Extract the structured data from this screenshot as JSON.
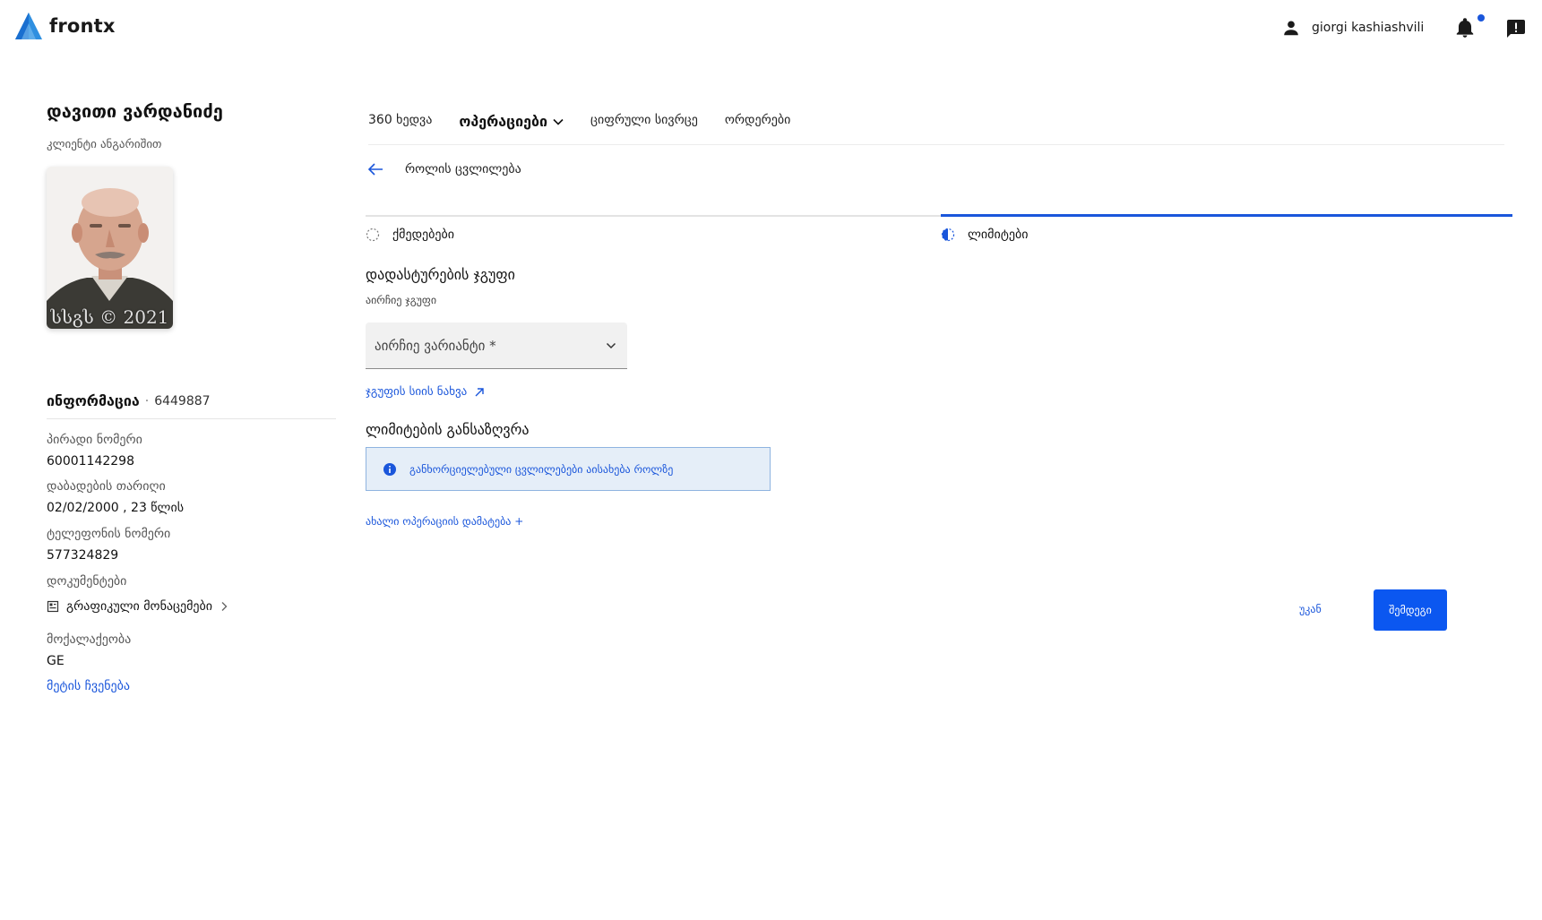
{
  "app": {
    "logo_text": "frontx",
    "user_name": "giorgi kashiashvili",
    "brand_color": "#1a56db",
    "primary_button_color": "#0b57f0"
  },
  "client": {
    "name": "დავითი ვარდანიძე",
    "subtitle": "კლიენტი ანგარიშით",
    "photo_caption": "სსგს © 2021"
  },
  "info": {
    "title": "ინფორმაცია",
    "separator": "·",
    "id": "6449887",
    "fields": [
      {
        "label": "პირადი ნომერი",
        "value": "60001142298"
      },
      {
        "label": "დაბადების თარიღი",
        "value": "02/02/2000 , 23 წლის"
      },
      {
        "label": "ტელეფონის ნომერი",
        "value": "577324829"
      },
      {
        "label": "დოკუმენტები",
        "value": ""
      },
      {
        "label": "მოქალაქეობა",
        "value": "GE"
      }
    ],
    "documents_link": "გრაფიკული მონაცემები",
    "show_more": "მეტის ჩვენება"
  },
  "nav": {
    "items": [
      {
        "label": "360 ხედვა"
      },
      {
        "label": "ოპერაციები"
      },
      {
        "label": "ციფრული სივრცე"
      },
      {
        "label": "ორდერები"
      }
    ]
  },
  "page": {
    "back_title": "როლის ცვლილება"
  },
  "stepper": {
    "steps": [
      {
        "label": "ქმედებები"
      },
      {
        "label": "ლიმიტები"
      }
    ]
  },
  "form": {
    "group_title": "დადასტურების ჯგუფი",
    "group_subtitle": "აირჩიე ჯგუფი",
    "select_placeholder": "აირჩიე ვარიანტი *",
    "group_list_link": "ჯგუფის სიის ნახვა",
    "limits_title": "ლიმიტების განსაზღვრა",
    "alert_text": "განხორციელებული ცვლილებები აისახება როლზე",
    "add_operation": "ახალი ოპერაციის დამატება +"
  },
  "actions": {
    "back_label": "უკან",
    "next_label": "შემდეგი"
  }
}
